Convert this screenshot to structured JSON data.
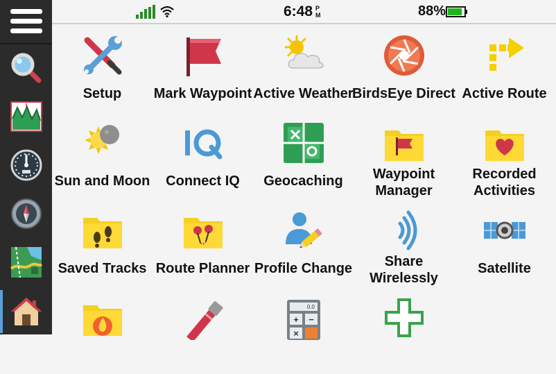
{
  "status_bar": {
    "time": "6:48",
    "ampm_top": "P",
    "ampm_bottom": "M",
    "battery": "88%",
    "battery_level": 0.88,
    "signal_icon": "cell-signal-icon",
    "wifi_icon": "wifi-icon"
  },
  "sidebar": {
    "items": [
      {
        "name": "menu",
        "icon": "hamburger-menu-icon"
      },
      {
        "name": "search",
        "icon": "magnifier-icon"
      },
      {
        "name": "elevation-plot",
        "icon": "elevation-chart-icon"
      },
      {
        "name": "trip-computer",
        "icon": "speedometer-icon"
      },
      {
        "name": "compass",
        "icon": "compass-icon"
      },
      {
        "name": "map",
        "icon": "map-icon"
      },
      {
        "name": "home",
        "icon": "home-icon",
        "active": true
      }
    ]
  },
  "apps": [
    {
      "label": "Setup",
      "icon": "setup-tools-icon"
    },
    {
      "label": "Mark Waypoint",
      "icon": "flag-icon"
    },
    {
      "label": "Active Weather",
      "icon": "weather-sun-cloud-icon"
    },
    {
      "label": "BirdsEye Direct",
      "icon": "birdseye-aperture-icon"
    },
    {
      "label": "Active Route",
      "icon": "route-arrow-icon"
    },
    {
      "label": "Sun and Moon",
      "icon": "sun-moon-icon"
    },
    {
      "label": "Connect IQ",
      "icon": "connect-iq-icon"
    },
    {
      "label": "Geocaching",
      "icon": "geocaching-icon"
    },
    {
      "label1": "Waypoint",
      "label2": "Manager",
      "icon": "waypoint-folder-icon"
    },
    {
      "label1": "Recorded",
      "label2": "Activities",
      "icon": "heart-folder-icon"
    },
    {
      "label": "Saved Tracks",
      "icon": "footprints-folder-icon"
    },
    {
      "label": "Route Planner",
      "icon": "pins-folder-icon"
    },
    {
      "label": "Profile Change",
      "icon": "profile-pencil-icon"
    },
    {
      "label1": "Share",
      "label2": "Wirelessly",
      "icon": "wireless-share-icon"
    },
    {
      "label": "Satellite",
      "icon": "satellite-icon"
    },
    {
      "label": "",
      "icon": "flame-folder-icon"
    },
    {
      "label": "",
      "icon": "flashlight-icon"
    },
    {
      "label": "",
      "icon": "calculator-icon"
    },
    {
      "label": "",
      "icon": "plus-add-icon"
    }
  ],
  "colors": {
    "sidebar_bg": "#2b2b2b",
    "content_bg": "#f4f4f4",
    "folder_yellow": "#f5cf22",
    "flag_red": "#d0364a",
    "battery_green": "#1fb51f"
  }
}
